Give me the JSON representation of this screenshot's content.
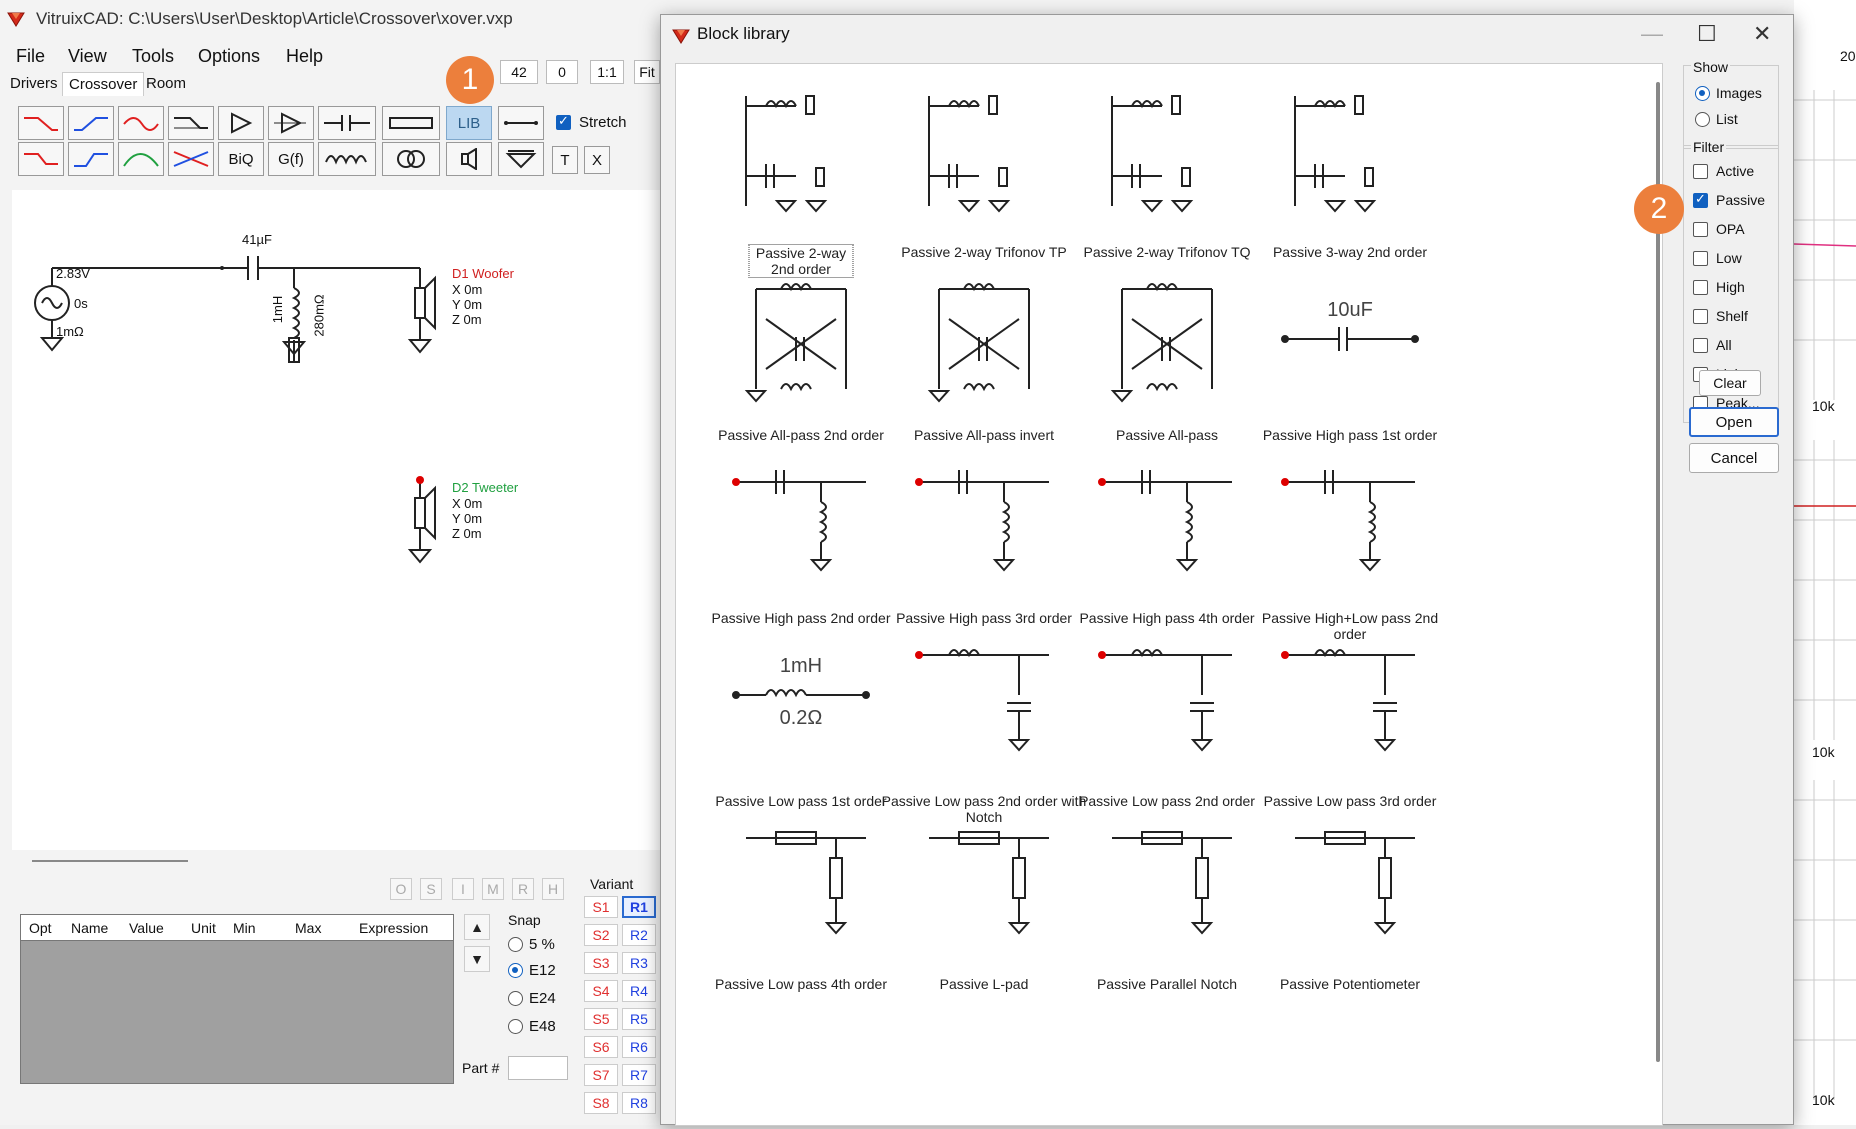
{
  "main": {
    "title": "VitruixCAD: C:\\Users\\User\\Desktop\\Article\\Crossover\\xover.vxp",
    "menu": [
      "File",
      "View",
      "Tools",
      "Options",
      "Help"
    ],
    "tabs": [
      "Drivers",
      "Crossover",
      "Room"
    ],
    "top_fields": [
      "42",
      "0",
      "1:1",
      "Fit"
    ],
    "toolbar_text": {
      "lib": "LIB",
      "biq": "BiQ",
      "gf": "G(f)",
      "t": "T",
      "x": "X",
      "stretch": "Stretch"
    },
    "schematic": {
      "cap_label": "41µF",
      "source_v": "2.83V",
      "source_t": "0s",
      "source_r": "1mΩ",
      "ind_l": "1mH",
      "ind_r": "280mΩ",
      "d1_name": "D1 Woofer",
      "d2_name": "D2 Tweeter",
      "x": "X 0m",
      "y": "Y 0m",
      "z": "Z 0m"
    },
    "mini_buttons": [
      "O",
      "S",
      "I",
      "M",
      "R",
      "H"
    ],
    "table_headers": [
      "Opt",
      "Name",
      "Value",
      "Unit",
      "Min",
      "Max",
      "Expression"
    ],
    "snap": {
      "label": "Snap",
      "options": [
        "5 %",
        "E12",
        "E24",
        "E48"
      ],
      "selected": "E12"
    },
    "variant": {
      "label": "Variant",
      "s": [
        "S1",
        "S2",
        "S3",
        "S4",
        "S5",
        "S6",
        "S7",
        "S8"
      ],
      "r": [
        "R1",
        "R2",
        "R3",
        "R4",
        "R5",
        "R6",
        "R7",
        "R8"
      ],
      "selected": "R1"
    },
    "part_label": "Part #"
  },
  "dialog": {
    "title": "Block library",
    "items": [
      "Passive 2-way 2nd order",
      "Passive 2-way Trifonov TP",
      "Passive 2-way Trifonov TQ",
      "Passive 3-way 2nd order",
      "Passive All-pass 2nd order",
      "Passive All-pass invert",
      "Passive All-pass",
      "Passive High pass 1st order",
      "Passive High pass 2nd order",
      "Passive High pass 3rd order",
      "Passive High pass 4th order",
      "Passive High+Low pass 2nd order",
      "Passive Low pass 1st order",
      "Passive Low pass 2nd order with Notch",
      "Passive Low pass 2nd order",
      "Passive Low pass 3rd order",
      "Passive Low pass 4th order",
      "Passive L-pad",
      "Passive Parallel Notch",
      "Passive Potentiometer"
    ],
    "show": {
      "label": "Show",
      "options": [
        "Images",
        "List"
      ],
      "selected": "Images"
    },
    "filter": {
      "label": "Filter",
      "options": [
        "Active",
        "Passive",
        "OPA",
        "Low",
        "High",
        "Shelf",
        "All",
        "Link",
        "Peak..."
      ],
      "checked": [
        "Passive"
      ]
    },
    "clear": "Clear",
    "open": "Open",
    "cancel": "Cancel",
    "thumb_text": {
      "hp1_cap": "10uF",
      "lp1_ind": "1mH",
      "lp1_r": "0.2Ω"
    }
  },
  "callouts": [
    "1",
    "2"
  ],
  "right_labels": [
    "10k",
    "10k",
    "10k"
  ],
  "right_top": "20"
}
